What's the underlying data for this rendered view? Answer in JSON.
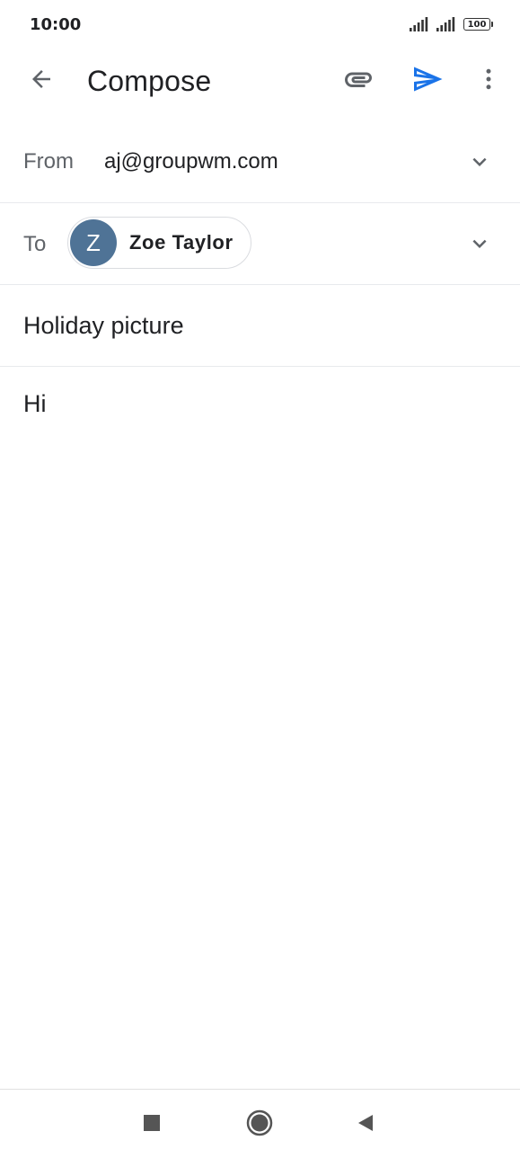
{
  "status_bar": {
    "time": "10:00",
    "battery": "100",
    "icons": [
      "signal-icon",
      "signal-icon",
      "battery-icon"
    ]
  },
  "app_bar": {
    "title": "Compose",
    "icons": [
      "back-arrow-icon",
      "paperclip-icon",
      "send-icon",
      "more-vert-icon"
    ],
    "accent_color": "#1a73e8"
  },
  "compose": {
    "from_label": "From",
    "from_value": "aj@groupwm.com",
    "to_label": "To",
    "recipient": {
      "initial": "Z",
      "name": "Zoe Taylor",
      "avatar_color": "#4f7396"
    },
    "subject": "Holiday picture",
    "body": "Hi"
  },
  "nav_bar": {
    "icons": [
      "recents-square-icon",
      "home-circle-icon",
      "back-triangle-icon"
    ]
  }
}
